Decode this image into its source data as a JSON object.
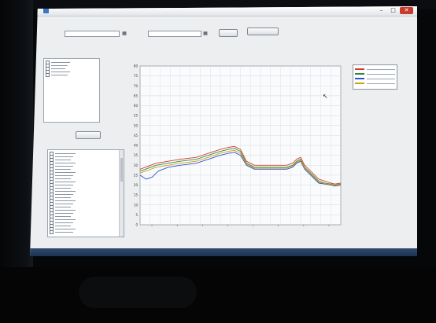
{
  "window": {
    "title": "",
    "minimize_icon": "minimize-icon",
    "maximize_icon": "maximize-icon",
    "close_icon": "close-icon",
    "minimize_glyph": "–",
    "maximize_glyph": "□",
    "close_glyph": "✕"
  },
  "query": {
    "start_label": "",
    "start_value": "",
    "end_label": "",
    "end_value": "",
    "calendar_icon": "calendar-icon",
    "calendar_glyph": "▦",
    "query_button": "",
    "print_button": ""
  },
  "left_panel": {
    "list1_title": "",
    "list1_rows": 5,
    "action_button": "",
    "list2_title": "",
    "list2_rows": 26
  },
  "chart_data": {
    "type": "line",
    "title": "",
    "xlabel": "",
    "ylabel": "",
    "ylim": [
      0,
      80
    ],
    "yticks": [
      0,
      5,
      10,
      15,
      20,
      25,
      30,
      35,
      40,
      45,
      50,
      55,
      60,
      65,
      70,
      75,
      80
    ],
    "xlim": [
      0,
      100
    ],
    "xtick_labels": [
      "",
      "",
      "",
      "",
      "",
      "",
      "",
      ""
    ],
    "grid": true,
    "legend_position": "outside-right",
    "series": [
      {
        "color": "#d43b2c",
        "x": [
          0,
          8,
          14,
          20,
          28,
          34,
          40,
          44,
          47,
          50,
          53,
          57,
          62,
          66,
          70,
          73,
          76,
          78,
          80,
          82,
          85,
          89,
          92,
          95,
          97,
          100
        ],
        "y": [
          28,
          31,
          32,
          33,
          34,
          36,
          38,
          39,
          39.5,
          38,
          32,
          30,
          30,
          30,
          30,
          30,
          31,
          33,
          34,
          30,
          27,
          23,
          22,
          21,
          20.5,
          21
        ]
      },
      {
        "color": "#2e8b3a",
        "x": [
          0,
          8,
          14,
          20,
          28,
          34,
          40,
          44,
          47,
          50,
          53,
          57,
          62,
          66,
          70,
          73,
          76,
          78,
          80,
          82,
          85,
          89,
          92,
          95,
          97,
          100
        ],
        "y": [
          27,
          30,
          31,
          32,
          33,
          35,
          37,
          38,
          38.5,
          37,
          31,
          29,
          29,
          29,
          29,
          29,
          30,
          32,
          33,
          29,
          26,
          22,
          21,
          20.5,
          20,
          20.5
        ]
      },
      {
        "color": "#2d4fd4",
        "x": [
          0,
          3,
          6,
          9,
          14,
          20,
          28,
          34,
          40,
          44,
          47,
          50,
          53,
          57,
          62,
          66,
          70,
          73,
          76,
          78,
          80,
          82,
          85,
          89,
          92,
          95,
          97,
          100
        ],
        "y": [
          25,
          23,
          24,
          27,
          29,
          30,
          31,
          33,
          35,
          36,
          36.5,
          35,
          30,
          28,
          28,
          28,
          28,
          28,
          29,
          31,
          32,
          28,
          25,
          21,
          20.5,
          20,
          19.5,
          20
        ]
      },
      {
        "color": "#c9a21a",
        "x": [
          0,
          8,
          14,
          20,
          28,
          34,
          40,
          44,
          47,
          50,
          53,
          57,
          62,
          66,
          70,
          73,
          76,
          78,
          80,
          82,
          85,
          89,
          92,
          95,
          97,
          100
        ],
        "y": [
          26,
          29,
          30,
          31,
          32,
          34,
          36,
          37,
          37.5,
          36,
          30.5,
          28.5,
          28.5,
          28.5,
          28.5,
          28.5,
          29.5,
          31.5,
          32.5,
          28.5,
          25.5,
          21.5,
          20.8,
          20.2,
          19.8,
          20.2
        ]
      }
    ]
  },
  "legend": {
    "item_count": 4
  },
  "cursor_icon": "mouse-cursor-icon",
  "cursor_glyph": "↖"
}
